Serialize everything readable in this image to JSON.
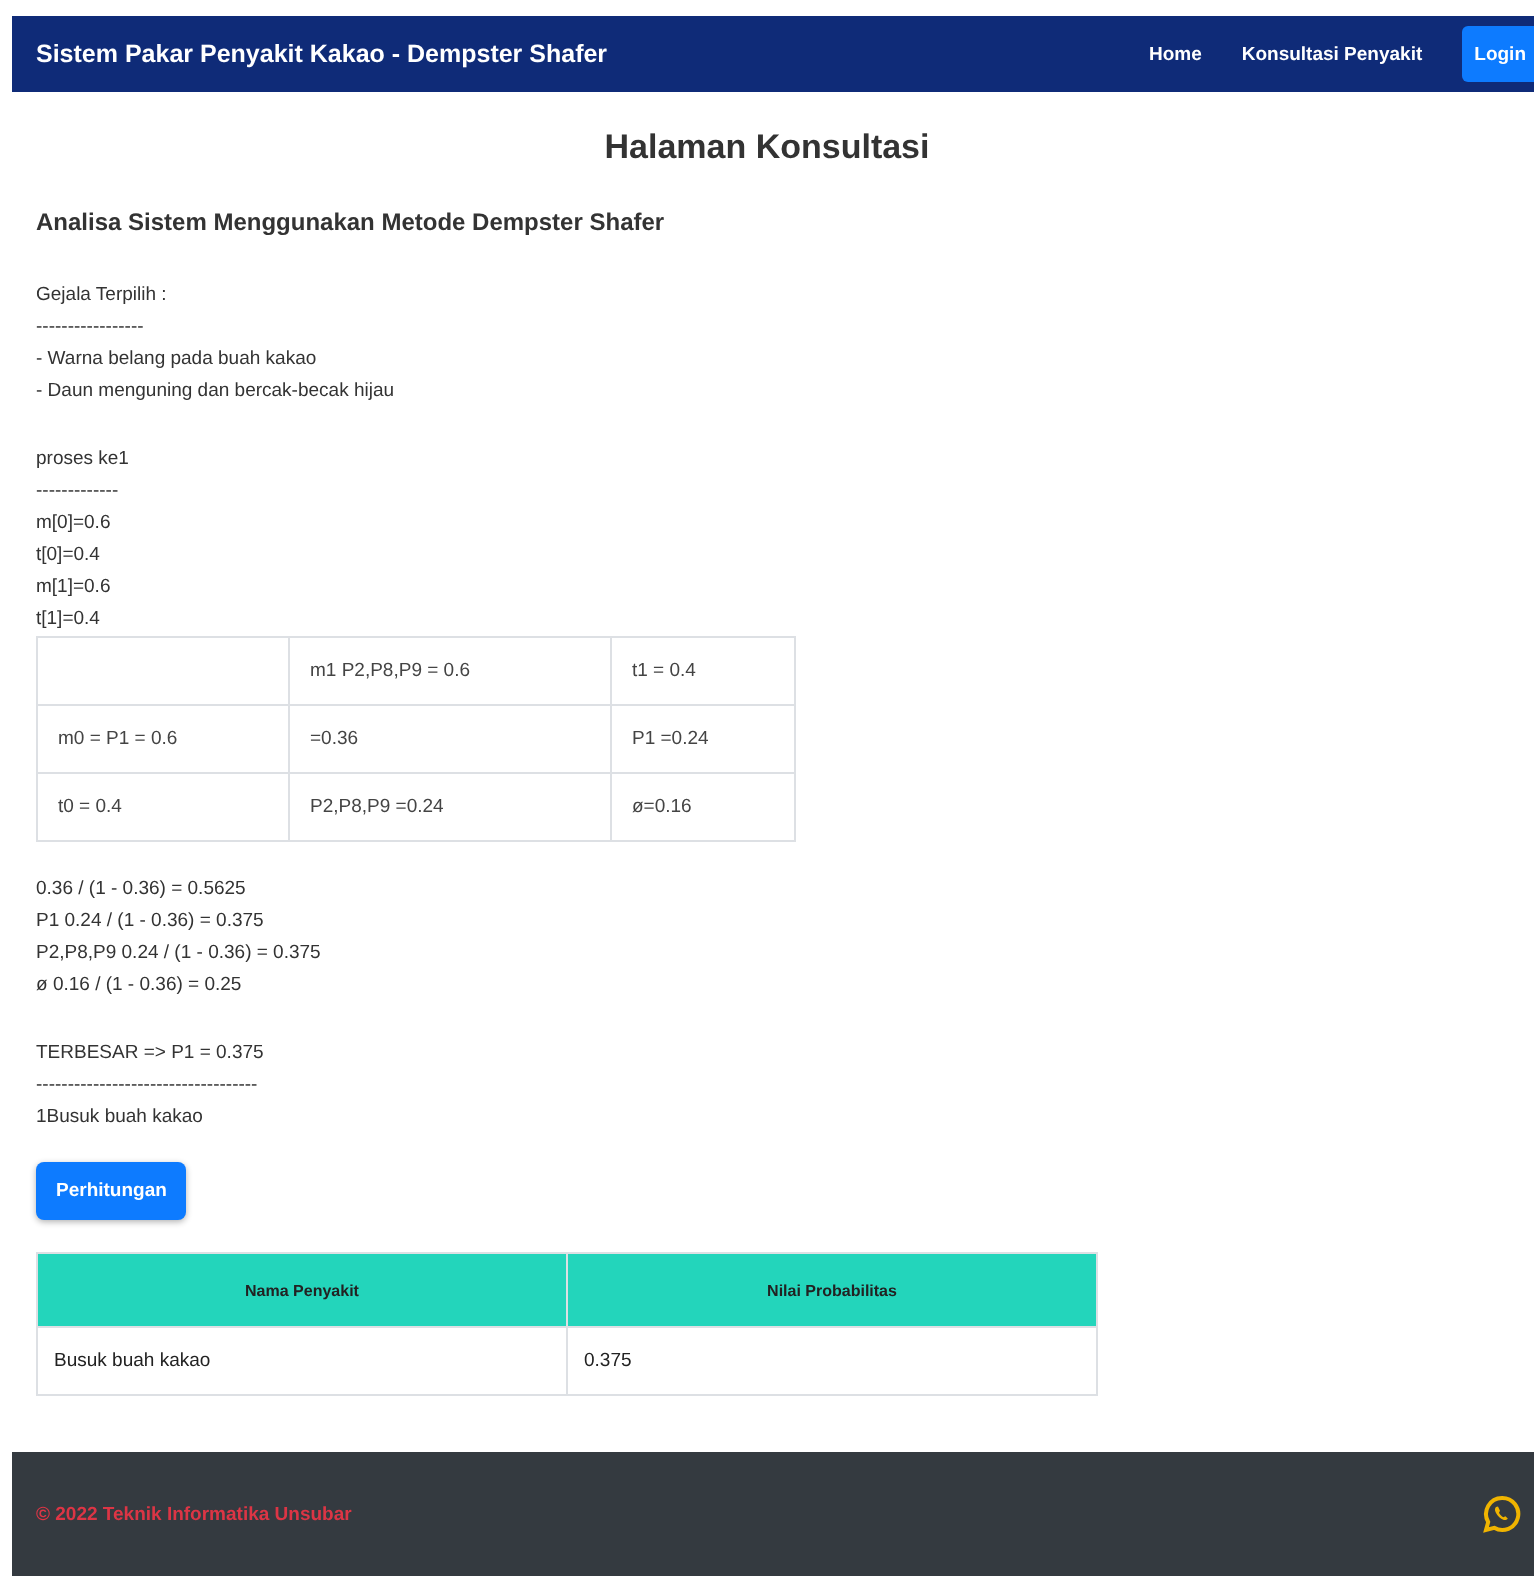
{
  "navbar": {
    "brand": "Sistem Pakar Penyakit Kakao - Dempster Shafer",
    "links": [
      {
        "label": "Home",
        "kind": "link"
      },
      {
        "label": "Konsultasi Penyakit",
        "kind": "link"
      },
      {
        "label": "Login",
        "kind": "button"
      }
    ]
  },
  "page_title": "Halaman Konsultasi",
  "section_title": "Analisa Sistem Menggunakan Metode Dempster Shafer",
  "symptoms_block": [
    "Gejala Terpilih :",
    "-----------------",
    "- Warna belang pada buah kakao",
    "- Daun menguning dan bercak-becak hijau"
  ],
  "process_block": [
    "proses ke1",
    "-------------",
    "m[0]=0.6",
    "t[0]=0.4",
    "m[1]=0.6",
    "t[1]=0.4"
  ],
  "matrix": {
    "column_headers": [
      "m1 P2,P8,P9 = 0.6",
      "t1 = 0.4"
    ],
    "rows": [
      {
        "header": "m0 = P1 = 0.6",
        "cells": [
          "=0.36",
          "P1 =0.24"
        ]
      },
      {
        "header": "t0 = 0.4",
        "cells": [
          "P2,P8,P9 =0.24",
          "ø=0.16"
        ]
      }
    ]
  },
  "results_block": [
    "0.36 / (1 - 0.36) = 0.5625",
    "P1 0.24 / (1 - 0.36) = 0.375",
    "P2,P8,P9 0.24 / (1 - 0.36) = 0.375",
    "ø 0.16 / (1 - 0.36) = 0.25"
  ],
  "conclusion_block": [
    "TERBESAR => P1 = 0.375",
    "-----------------------------------",
    "1Busuk buah kakao"
  ],
  "button": "Perhitungan",
  "table": {
    "columns": [
      "Nama Penyakit",
      "Nilai Probabilitas"
    ],
    "rows": [
      [
        "Busuk buah kakao",
        "0.375"
      ]
    ]
  },
  "footer": {
    "copyright": "© 2022 Teknik Informatika Unsubar"
  }
}
